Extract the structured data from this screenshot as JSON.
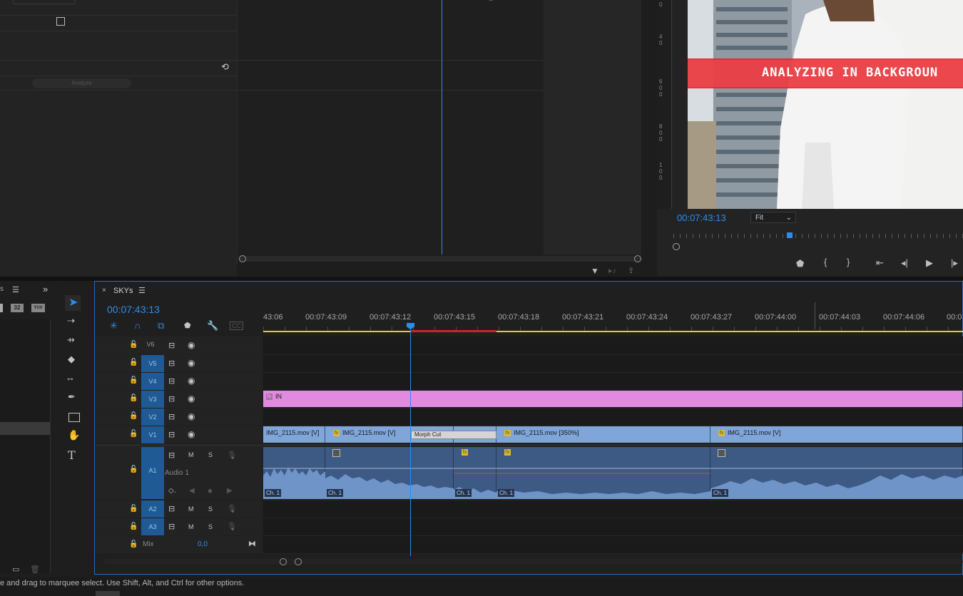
{
  "effect_controls": {
    "analyze_label": "Analyze"
  },
  "program_monitor": {
    "timecode": "00:07:43:13",
    "fit_label": "Fit",
    "video_banner_text": "ANALYZING IN BACKGROUN"
  },
  "timeline": {
    "sequence_name": "SKYs",
    "timecode": "00:07:43:13",
    "ruler_labels": [
      "43:06",
      "00:07:43:09",
      "00:07:43:12",
      "00:07:43:15",
      "00:07:43:18",
      "00:07:43:21",
      "00:07:43:24",
      "00:07:43:27",
      "00:07:44:00",
      "00:07:44:03",
      "00:07:44:06",
      "00:0"
    ],
    "video_tracks": [
      "V6",
      "V5",
      "V4",
      "V3",
      "V2",
      "V1"
    ],
    "audio_tracks": [
      "A1",
      "A2",
      "A3"
    ],
    "audio1_name": "Audio 1",
    "mix_label": "Mix",
    "mix_value": "0,0",
    "v3_clip": "IN",
    "v1_clips": [
      "IMG_2115.mov [V]",
      "IMG_2115.mov [V]",
      "Morph Cut",
      "IMG_2115.mov [350%]",
      "IMG_2115.mov [V]"
    ],
    "channel_label": "Ch. 1",
    "mute_label": "M",
    "solo_label": "S"
  },
  "project_panel": {
    "zoom_badge": "32",
    "yuv_badge": "YUV"
  },
  "status_bar": {
    "text": "e and drag to marquee select. Use Shift, Alt, and Ctrl for other options."
  },
  "colors": {
    "accent_blue": "#2d8ceb",
    "clip_video": "#7fa5d9",
    "clip_title": "#e08ae0",
    "clip_audio": "#3d5a85",
    "work_area_yellow": "#d9cf3c"
  }
}
